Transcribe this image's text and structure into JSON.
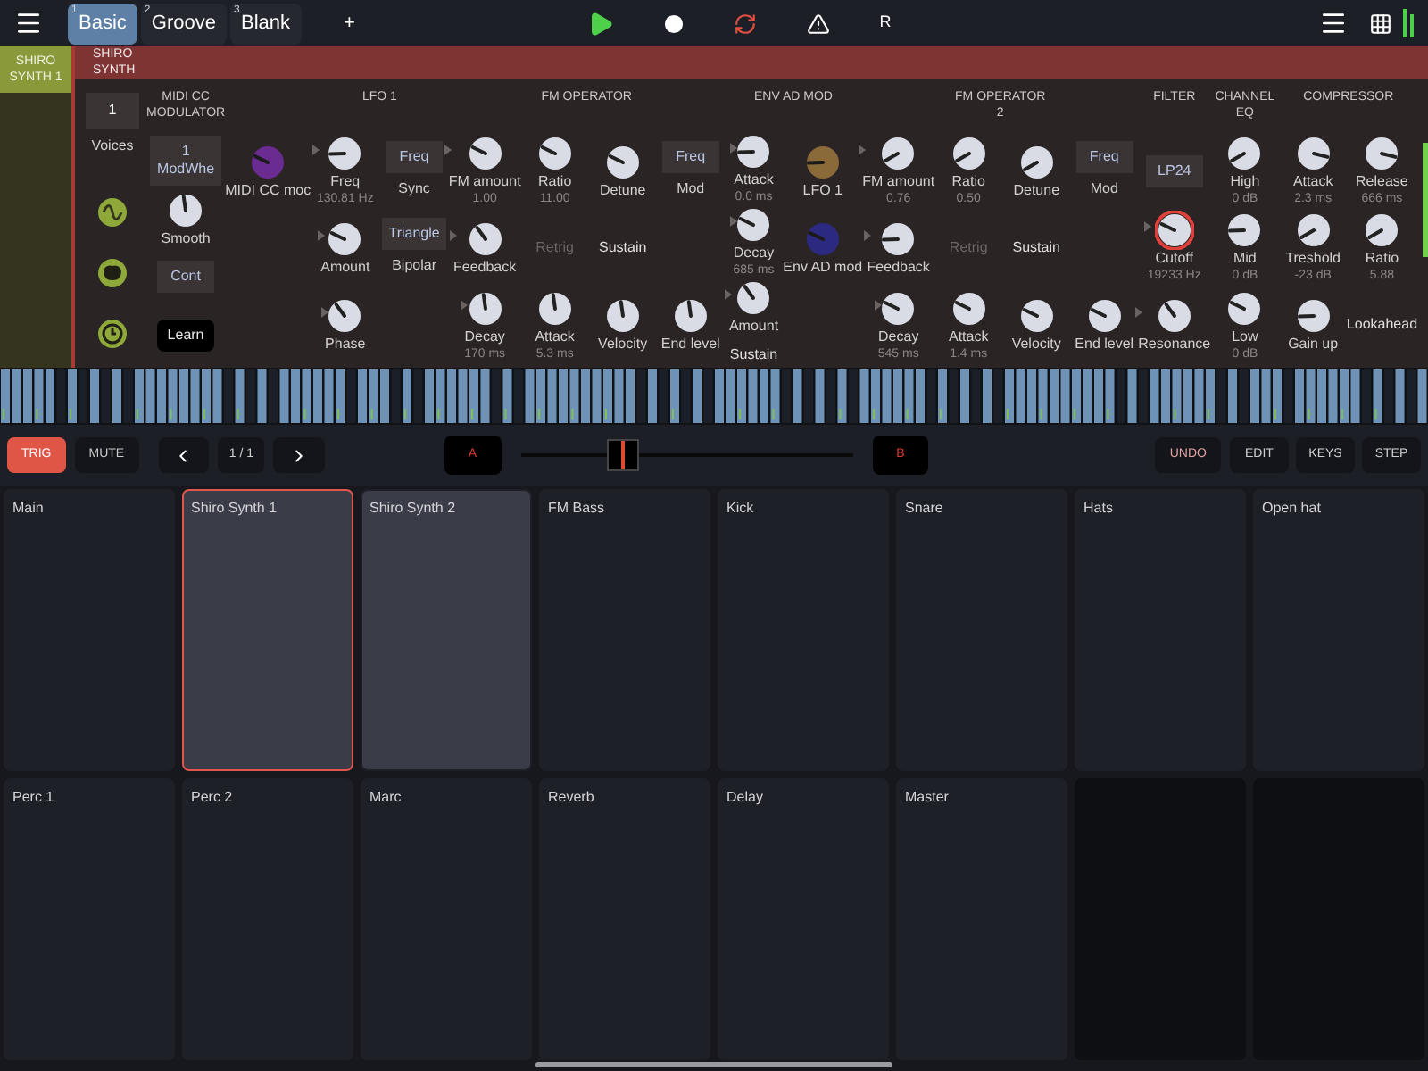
{
  "top_bar": {
    "tabs": [
      {
        "number": "1",
        "label": "Basic",
        "selected": true
      },
      {
        "number": "2",
        "label": "Groove",
        "selected": false
      },
      {
        "number": "3",
        "label": "Blank",
        "selected": false
      }
    ],
    "add_tab": "+",
    "record_label": "R"
  },
  "track": {
    "side_label": "SHIRO SYNTH 1",
    "header": "SHIRO SYNTH"
  },
  "synth": {
    "voices": {
      "value": "1",
      "label": "Voices"
    },
    "groups": [
      {
        "title": "MIDI CC MODULATOR",
        "columns": [
          [
            {
              "kind": "box",
              "text": "1\nModWhe"
            },
            {
              "kind": "knob",
              "label": "Smooth"
            },
            {
              "kind": "box",
              "text": "Cont"
            },
            {
              "kind": "button",
              "text": "Learn"
            }
          ]
        ]
      },
      {
        "columns": [
          [
            {
              "kind": "knob",
              "label": "MIDI CC moc",
              "color": "#6a2c91"
            },
            null,
            null
          ]
        ]
      },
      {
        "title": "LFO 1",
        "columns": [
          [
            {
              "kind": "knob",
              "label": "Freq",
              "value": "130.81 Hz",
              "mod": true
            },
            {
              "kind": "knob",
              "label": "Amount",
              "mod": true
            },
            {
              "kind": "knob",
              "label": "Phase",
              "mod": true
            }
          ],
          [
            {
              "kind": "box",
              "text": "Freq",
              "caption": "Sync"
            },
            {
              "kind": "box",
              "text": "Triangle",
              "caption": "Bipolar"
            },
            null
          ]
        ]
      },
      {
        "title": "FM OPERATOR",
        "columns": [
          [
            {
              "kind": "knob",
              "label": "FM amount",
              "value": "1.00",
              "mod": true
            },
            {
              "kind": "knob",
              "label": "Feedback",
              "mod": true
            },
            {
              "kind": "knob",
              "label": "Decay",
              "value": "170 ms",
              "mod": true
            }
          ],
          [
            {
              "kind": "knob",
              "label": "Ratio",
              "value": "11.00"
            },
            {
              "kind": "text",
              "text": "Retrig",
              "dim": true
            },
            {
              "kind": "knob",
              "label": "Attack",
              "value": "5.3 ms"
            }
          ],
          [
            {
              "kind": "knob",
              "label": "Detune"
            },
            {
              "kind": "text",
              "text": "Sustain",
              "dim": false
            },
            {
              "kind": "knob",
              "label": "Velocity"
            }
          ],
          [
            {
              "kind": "box",
              "text": "Freq",
              "caption": "Mod"
            },
            null,
            {
              "kind": "knob",
              "label": "End level"
            }
          ]
        ]
      },
      {
        "title": "ENV AD MOD",
        "columns": [
          [
            {
              "kind": "knob",
              "label": "Attack",
              "value": "0.0 ms",
              "mod": true
            },
            {
              "kind": "knob",
              "label": "Decay",
              "value": "685 ms",
              "mod": true
            },
            {
              "kind": "knob",
              "label": "Amount",
              "note": "Sustain",
              "mod": true
            }
          ],
          [
            {
              "kind": "knob",
              "label": "LFO 1",
              "color": "#8b6a3a"
            },
            {
              "kind": "knob",
              "label": "Env AD mod",
              "color": "#2c2a80"
            },
            null
          ]
        ]
      },
      {
        "title": "FM OPERATOR 2",
        "columns": [
          [
            {
              "kind": "knob",
              "label": "FM amount",
              "value": "0.76",
              "mod": true
            },
            {
              "kind": "knob",
              "label": "Feedback",
              "mod": true
            },
            {
              "kind": "knob",
              "label": "Decay",
              "value": "545 ms",
              "mod": true
            }
          ],
          [
            {
              "kind": "knob",
              "label": "Ratio",
              "value": "0.50"
            },
            {
              "kind": "text",
              "text": "Retrig",
              "dim": true
            },
            {
              "kind": "knob",
              "label": "Attack",
              "value": "1.4 ms"
            }
          ],
          [
            {
              "kind": "knob",
              "label": "Detune"
            },
            {
              "kind": "text",
              "text": "Sustain",
              "dim": false
            },
            {
              "kind": "knob",
              "label": "Velocity"
            }
          ],
          [
            {
              "kind": "box",
              "text": "Freq",
              "caption": "Mod"
            },
            null,
            {
              "kind": "knob",
              "label": "End level"
            }
          ]
        ]
      },
      {
        "title": "FILTER",
        "columns": [
          [
            {
              "kind": "box",
              "text": "LP24"
            },
            {
              "kind": "knob",
              "label": "Cutoff",
              "value": "19233 Hz",
              "mod": true,
              "highlight": true
            },
            {
              "kind": "knob",
              "label": "Resonance",
              "mod": true
            }
          ]
        ]
      },
      {
        "title": "CHANNEL EQ",
        "columns": [
          [
            {
              "kind": "knob",
              "label": "High",
              "value": "0 dB"
            },
            {
              "kind": "knob",
              "label": "Mid",
              "value": "0 dB"
            },
            {
              "kind": "knob",
              "label": "Low",
              "value": "0 dB"
            }
          ]
        ]
      },
      {
        "title": "COMPRESSOR",
        "columns": [
          [
            {
              "kind": "knob",
              "label": "Attack",
              "value": "2.3 ms"
            },
            {
              "kind": "knob",
              "label": "Treshold",
              "value": "-23 dB"
            },
            {
              "kind": "knob",
              "label": "Gain up"
            }
          ],
          [
            {
              "kind": "knob",
              "label": "Release",
              "value": "666 ms"
            },
            {
              "kind": "knob",
              "label": "Ratio",
              "value": "5.88"
            },
            {
              "kind": "text",
              "text": "Lookahead",
              "dim": false
            }
          ]
        ]
      }
    ]
  },
  "transport": {
    "trig": {
      "text": "TRIG",
      "on": true
    },
    "mute": {
      "text": "MUTE",
      "on": false
    },
    "pattern": "1 / 1",
    "a_label": "A",
    "b_label": "B",
    "undo": "UNDO",
    "modes": [
      "EDIT",
      "KEYS",
      "STEP"
    ]
  },
  "pads": [
    {
      "kind": "track",
      "label": "Main",
      "selected": false,
      "lit": false
    },
    {
      "kind": "track",
      "label": "Shiro Synth 1",
      "selected": true,
      "lit": true
    },
    {
      "kind": "track",
      "label": "Shiro Synth 2",
      "selected": false,
      "lit": true
    },
    {
      "kind": "track",
      "label": "FM Bass",
      "selected": false,
      "lit": false
    },
    {
      "kind": "track",
      "label": "Kick",
      "selected": false,
      "lit": false
    },
    {
      "kind": "track",
      "label": "Snare",
      "selected": false,
      "lit": false
    },
    {
      "kind": "track",
      "label": "Hats",
      "selected": false,
      "lit": false
    },
    {
      "kind": "track",
      "label": "Open hat",
      "selected": false,
      "lit": false
    },
    {
      "kind": "track",
      "label": "Perc 1",
      "selected": false,
      "lit": false
    },
    {
      "kind": "track",
      "label": "Perc 2",
      "selected": false,
      "lit": false
    },
    {
      "kind": "track",
      "label": "Marc",
      "selected": false,
      "lit": false
    },
    {
      "kind": "track",
      "label": "Reverb",
      "selected": false,
      "lit": false
    },
    {
      "kind": "track",
      "label": "Delay",
      "selected": false,
      "lit": false
    },
    {
      "kind": "track",
      "label": "Master",
      "selected": false,
      "lit": false
    },
    {
      "kind": "empty"
    },
    {
      "kind": "empty"
    }
  ]
}
